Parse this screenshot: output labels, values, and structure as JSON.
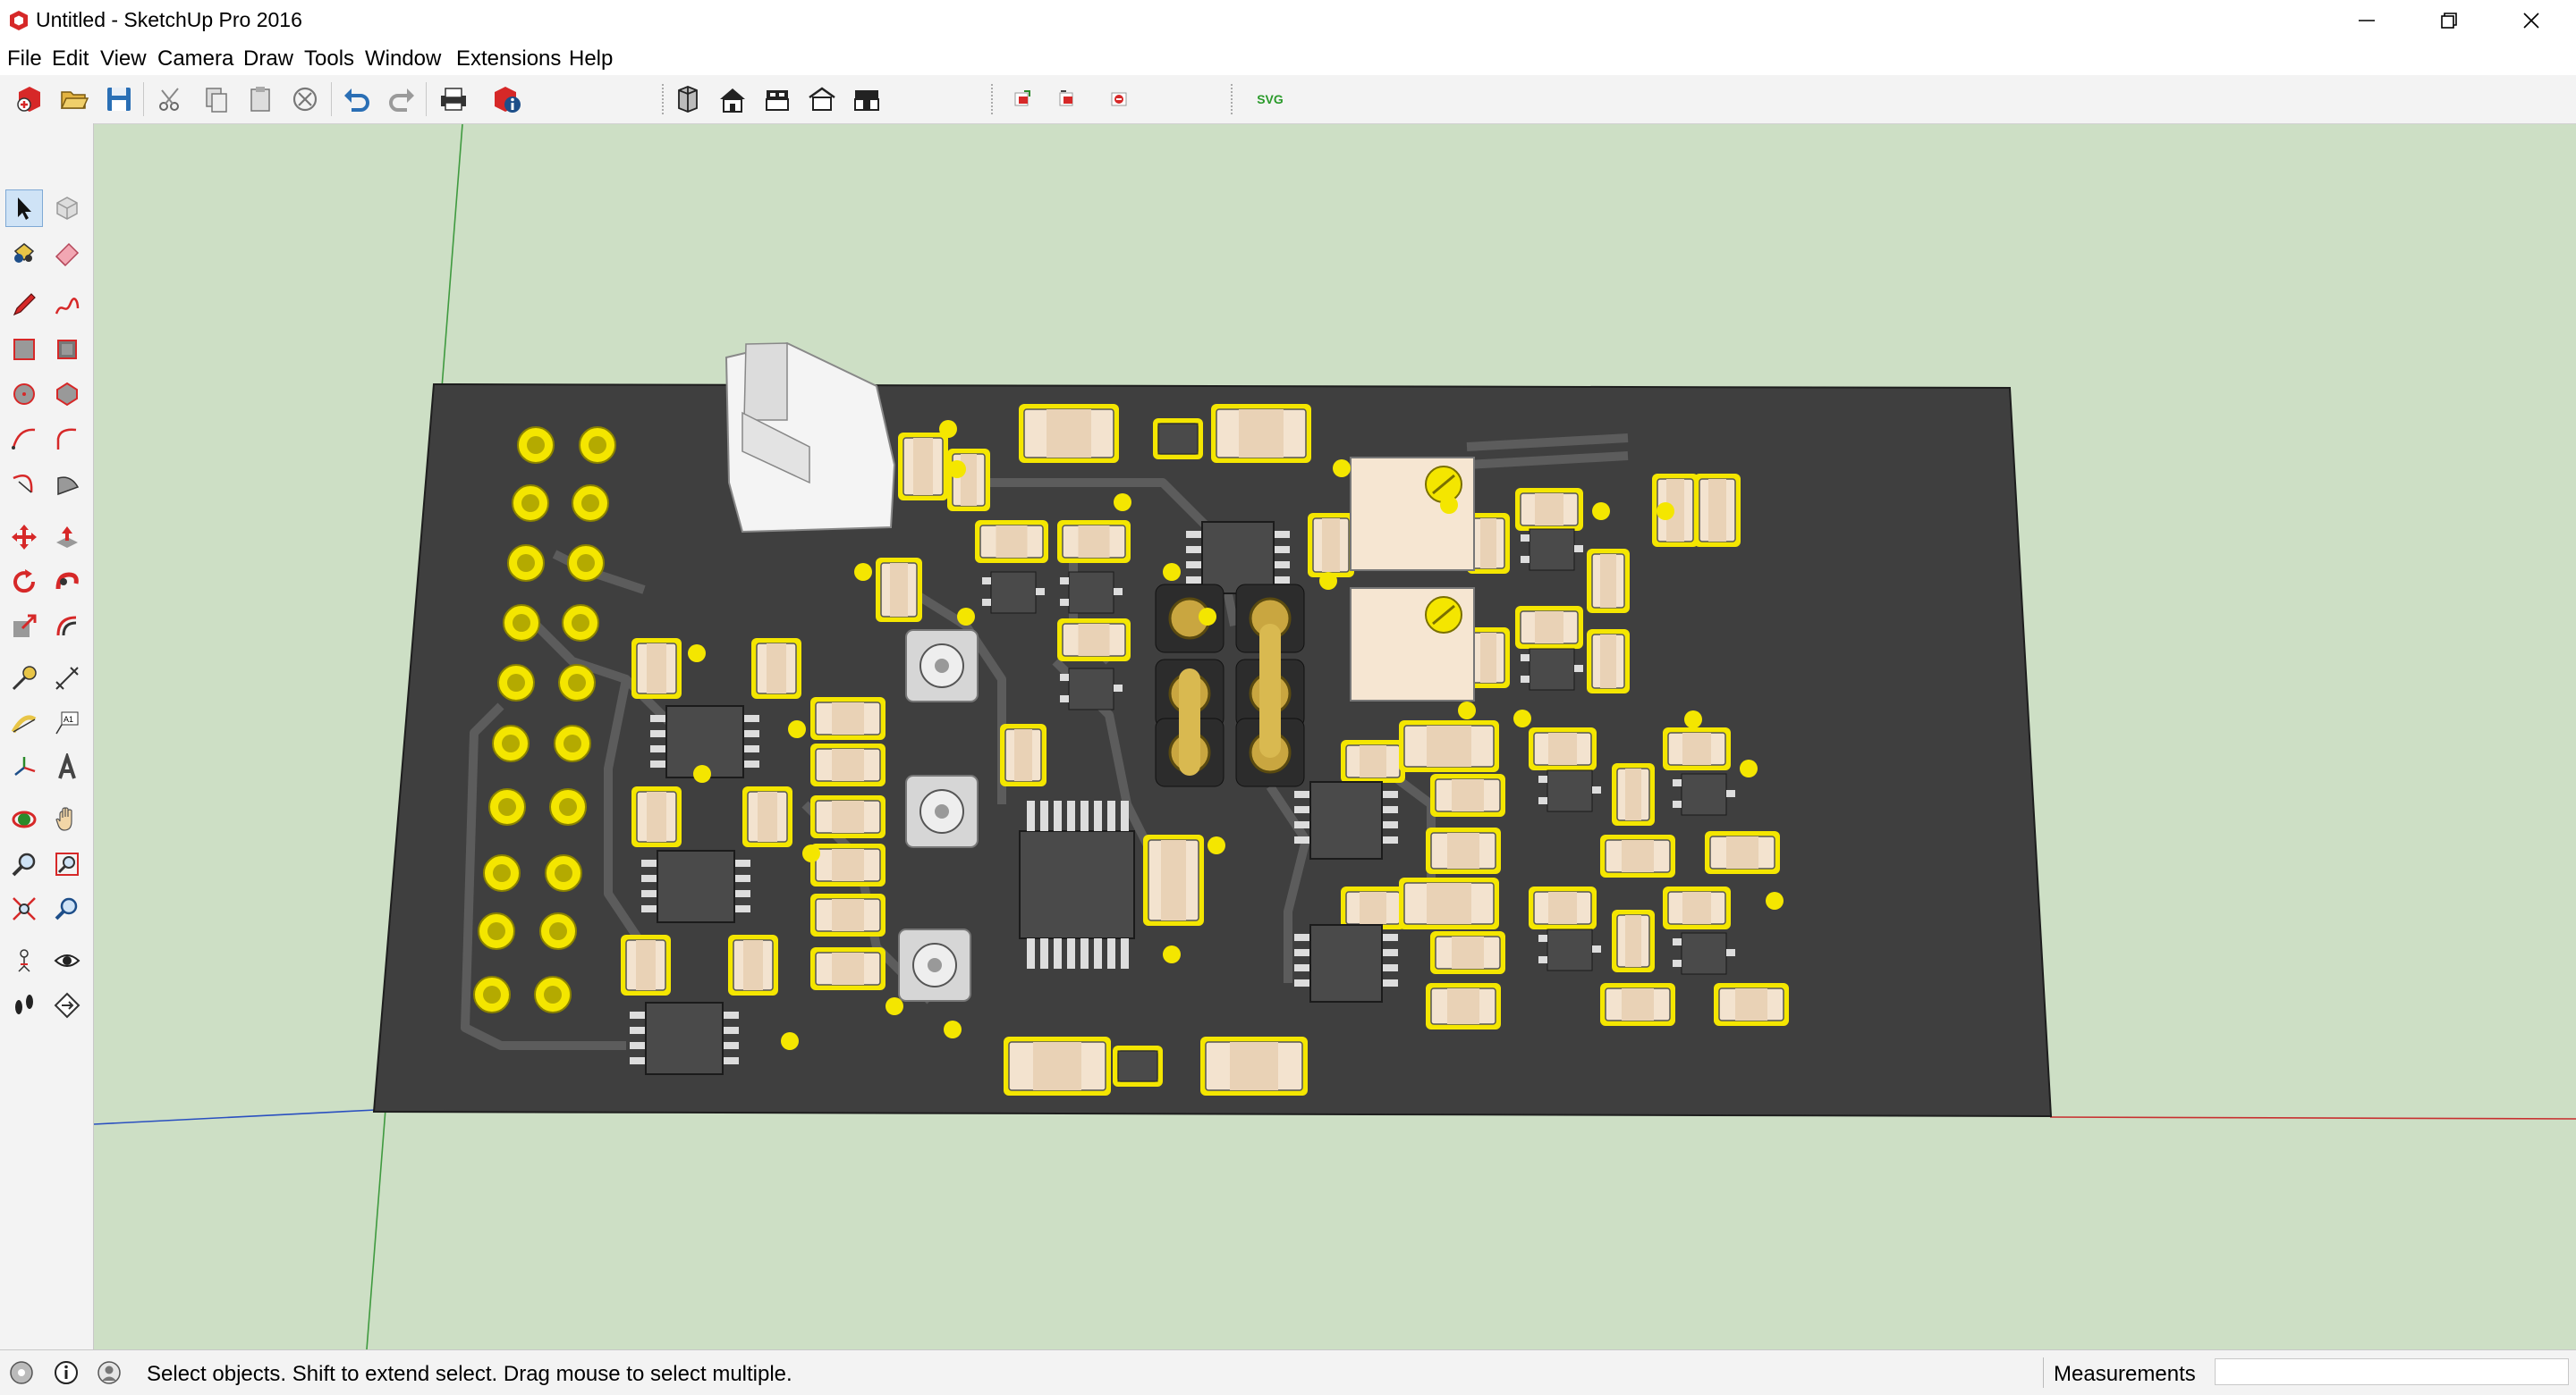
{
  "window": {
    "title": "Untitled - SketchUp Pro 2016",
    "controls": [
      "minimize",
      "restore",
      "close"
    ]
  },
  "menu": {
    "items": [
      "File",
      "Edit",
      "View",
      "Camera",
      "Draw",
      "Tools",
      "Window",
      "Extensions",
      "Help"
    ]
  },
  "toolbar": {
    "svg_label": "SVG",
    "icons": [
      "new-file-icon",
      "open-folder-icon",
      "save-icon",
      "cut-icon",
      "copy-icon",
      "paste-icon",
      "erase-selection-icon",
      "undo-icon",
      "redo-icon",
      "print-icon",
      "model-info-icon",
      "iso-view-icon",
      "top-view-icon",
      "front-view-icon",
      "right-view-icon",
      "back-view-icon",
      "left-view-icon",
      "import-red-icon",
      "export-red-icon",
      "plugin-red-icon",
      "svg-export-icon"
    ]
  },
  "left_toolbar": {
    "tools": [
      "select",
      "make-component",
      "paint-bucket",
      "eraser",
      "line",
      "freehand",
      "rectangle",
      "rotated-rectangle",
      "circle",
      "polygon",
      "arc",
      "two-point-arc",
      "three-point-arc",
      "pie",
      "move",
      "push-pull",
      "rotate",
      "follow-me",
      "scale",
      "offset",
      "tape-measure",
      "dimension",
      "protractor",
      "text",
      "axes",
      "3d-text",
      "orbit",
      "pan",
      "zoom",
      "zoom-window",
      "zoom-extents",
      "previous-view",
      "position-camera",
      "look-around",
      "walk",
      "section-plane"
    ],
    "active": "select"
  },
  "status": {
    "message": "Select objects. Shift to extend select. Drag mouse to select multiple.",
    "measurements_label": "Measurements",
    "measurements_value": ""
  },
  "viewport": {
    "background": "#cddfc5",
    "board_color": "#3f3f3f",
    "pad_color": "#f4e600",
    "trace_color": "#5c5c5c"
  }
}
